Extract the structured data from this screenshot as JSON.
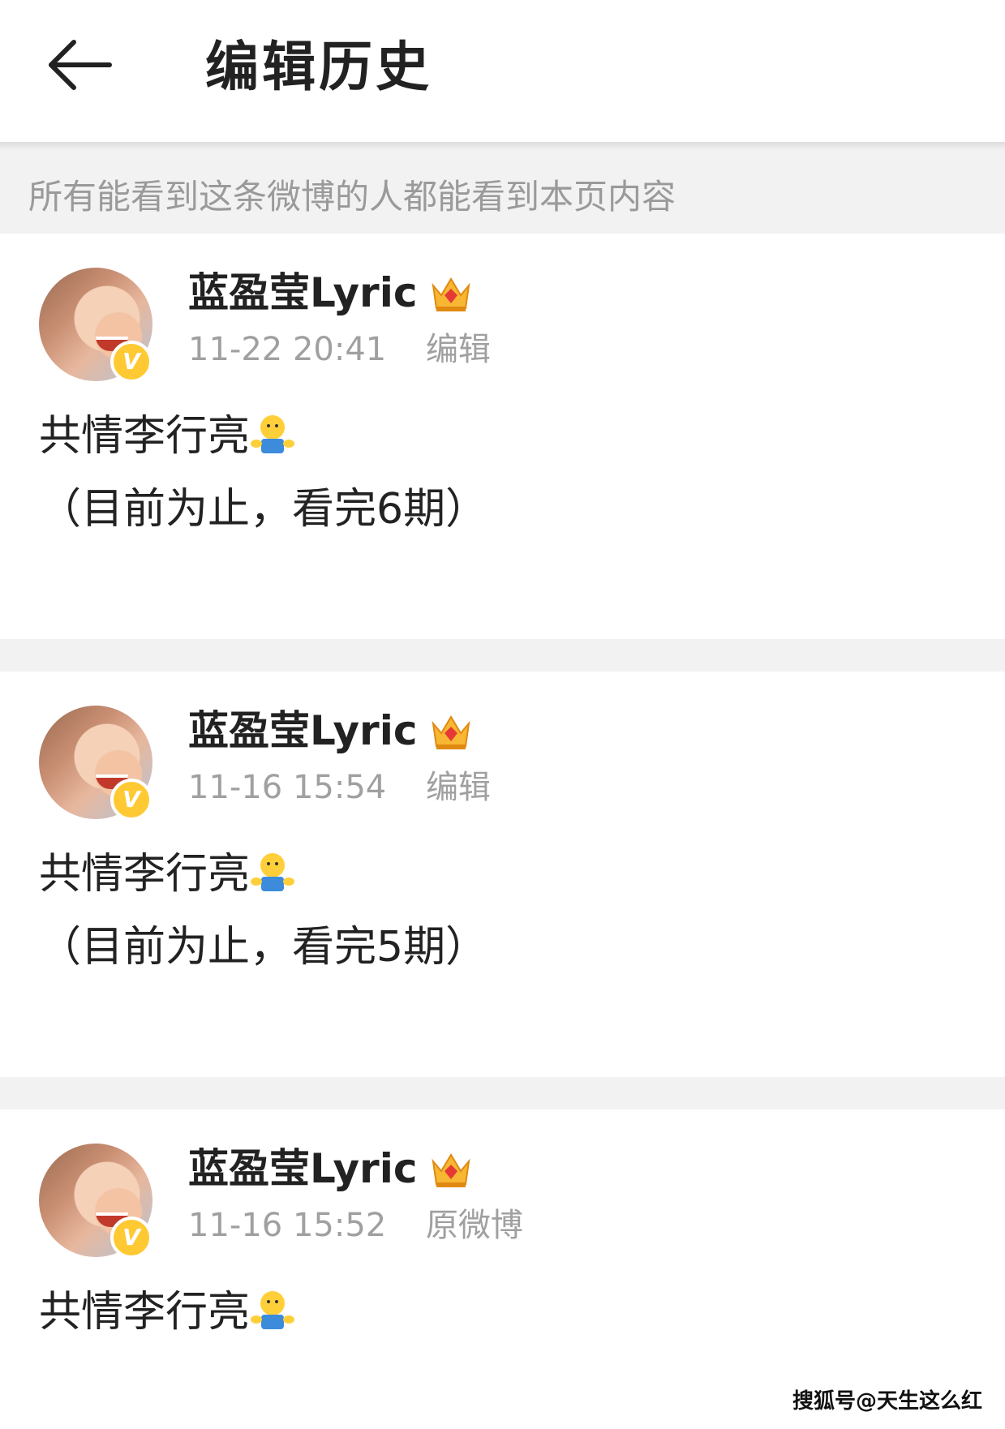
{
  "header": {
    "title": "编辑历史"
  },
  "notice": "所有能看到这条微博的人都能看到本页内容",
  "posts": [
    {
      "username": "蓝盈莹Lyric",
      "time": "11-22 20:41",
      "action": "编辑",
      "lines": [
        "共情李行亮",
        "（目前为止，看完6期）"
      ]
    },
    {
      "username": "蓝盈莹Lyric",
      "time": "11-16 15:54",
      "action": "编辑",
      "lines": [
        "共情李行亮",
        "（目前为止，看完5期）"
      ]
    },
    {
      "username": "蓝盈莹Lyric",
      "time": "11-16 15:52",
      "action": "原微博",
      "lines": [
        "共情李行亮"
      ]
    }
  ],
  "watermark": "搜狐号@天生这么红",
  "icons": {
    "back": "back-arrow-icon",
    "verified": "verified-v-icon",
    "crown": "crown-icon",
    "emoji": "hug-emoji-icon"
  },
  "colors": {
    "text": "#222222",
    "muted": "#a0a0a0",
    "background_gap": "#f2f2f2",
    "verified": "#ffc933"
  },
  "verified_letter": "V"
}
